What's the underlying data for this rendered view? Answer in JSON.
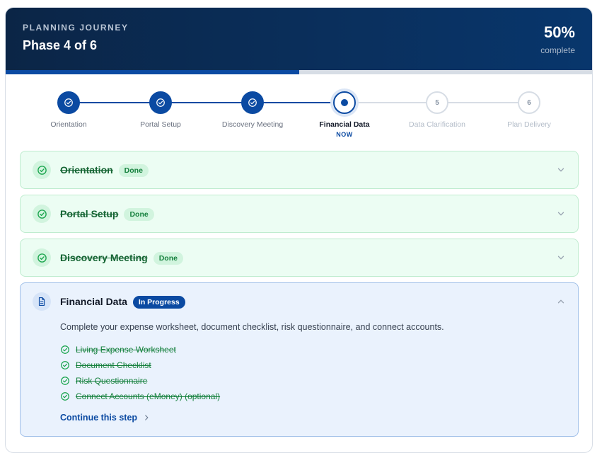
{
  "header": {
    "eyebrow": "PLANNING JOURNEY",
    "phase_label": "Phase 4 of 6",
    "percent": "50%",
    "percent_label": "complete",
    "progress_fraction": 0.5
  },
  "steps": [
    {
      "label": "Orientation",
      "state": "done",
      "number": ""
    },
    {
      "label": "Portal Setup",
      "state": "done",
      "number": ""
    },
    {
      "label": "Discovery Meeting",
      "state": "done",
      "number": ""
    },
    {
      "label": "Financial Data",
      "state": "current",
      "number": "",
      "now": "NOW"
    },
    {
      "label": "Data Clarification",
      "state": "todo",
      "number": "5"
    },
    {
      "label": "Plan Delivery",
      "state": "todo",
      "number": "6"
    }
  ],
  "phases": [
    {
      "title": "Orientation",
      "badge": "Done"
    },
    {
      "title": "Portal Setup",
      "badge": "Done"
    },
    {
      "title": "Discovery Meeting",
      "badge": "Done"
    }
  ],
  "active_phase": {
    "title": "Financial Data",
    "badge": "In Progress",
    "description": "Complete your expense worksheet, document checklist, risk questionnaire, and connect accounts.",
    "tasks": [
      "Living Expense Worksheet",
      "Document Checklist",
      "Risk Questionnaire",
      "Connect Accounts (eMoney) (optional)"
    ],
    "continue_label": "Continue this step"
  },
  "icons": {
    "check": "check-circle-icon",
    "document": "document-icon",
    "chevron_down": "chevron-down-icon",
    "chevron_up": "chevron-up-icon",
    "chevron_right": "chevron-right-icon"
  },
  "colors": {
    "primary": "#0b4aa2",
    "header_bg": "#0b2546",
    "success": "#15803d",
    "success_bg": "#ecfdf3",
    "active_bg": "#eaf2fd"
  }
}
